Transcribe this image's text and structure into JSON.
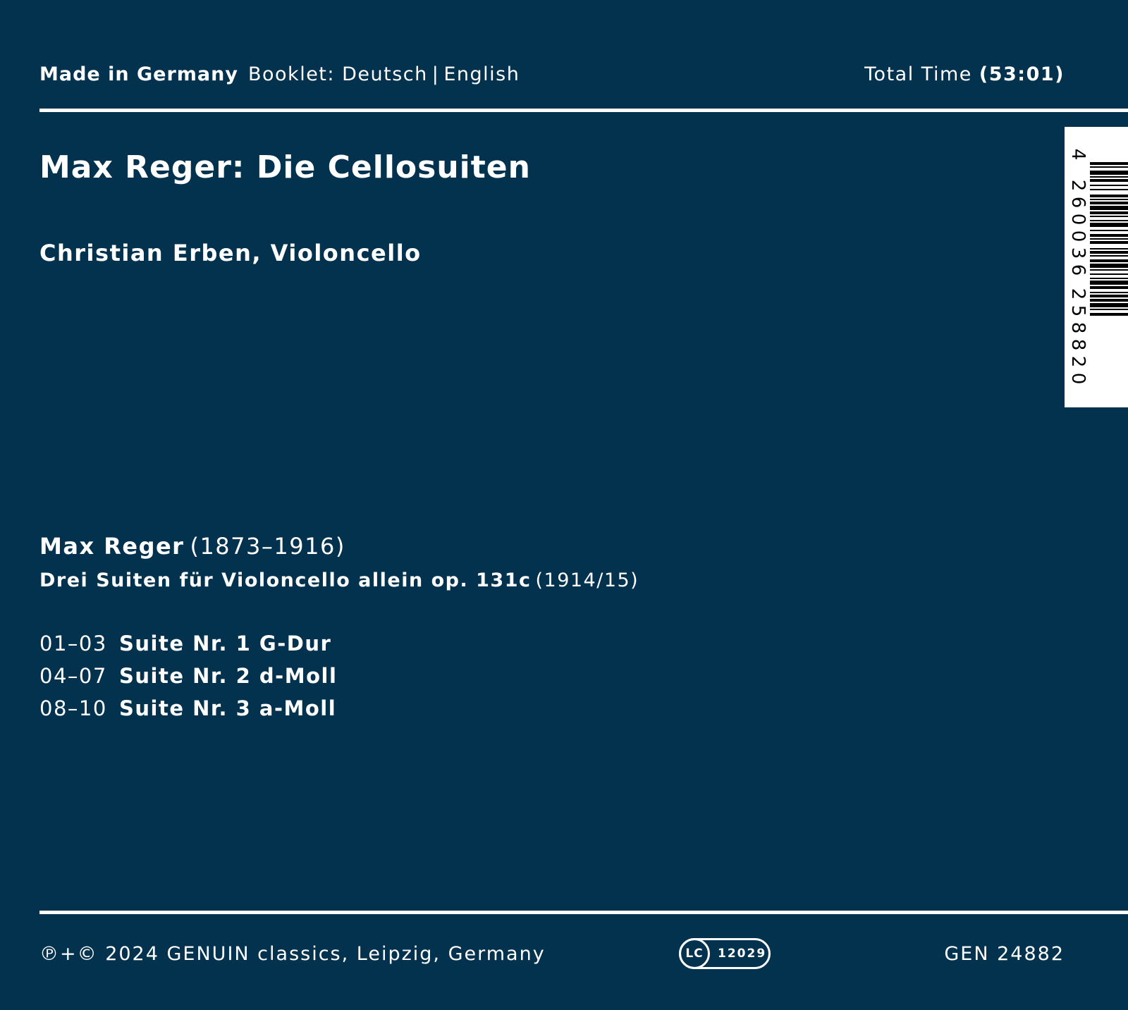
{
  "header": {
    "made_in": "Made in Germany",
    "booklet_label": "Booklet:",
    "booklet_lang_1": "Deutsch",
    "booklet_separator": "|",
    "booklet_lang_2": "English",
    "total_time_label": "Total Time",
    "total_time_value": "(53:01)"
  },
  "album": {
    "title": "Max Reger: Die Cellosuiten",
    "performer": "Christian Erben, Violoncello"
  },
  "barcode": {
    "digits": [
      "4",
      "2",
      "6",
      "0",
      "0",
      "3",
      "6",
      "2",
      "5",
      "8",
      "8",
      "2",
      "0"
    ]
  },
  "program": {
    "composer_name": "Max Reger",
    "composer_dates": "(1873–1916)",
    "work_title": "Drei Suiten für Violoncello allein op. 131c",
    "work_year": "(1914/15)",
    "tracks": [
      {
        "num": "01–03",
        "title": "Suite Nr. 1 G-Dur"
      },
      {
        "num": "04–07",
        "title": "Suite Nr. 2 d-Moll"
      },
      {
        "num": "08–10",
        "title": "Suite Nr. 3 a-Moll"
      }
    ]
  },
  "footer": {
    "copyright": "℗+© 2024 GENUIN classics, Leipzig, Germany",
    "lc_label": "LC",
    "lc_code": "12029",
    "catalog_number": "GEN 24882"
  },
  "colors": {
    "background": "#03324f",
    "text": "#ffffff"
  }
}
